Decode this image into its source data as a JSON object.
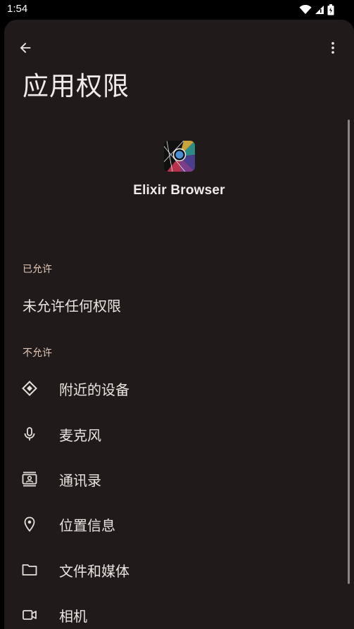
{
  "status_bar": {
    "time": "1:54"
  },
  "header": {
    "title": "应用权限"
  },
  "app": {
    "name": "Elixir Browser"
  },
  "sections": {
    "allowed": {
      "label": "已允许",
      "empty_text": "未允许任何权限"
    },
    "denied": {
      "label": "不允许",
      "items": [
        {
          "label": "附近的设备",
          "icon": "nearby-devices-icon"
        },
        {
          "label": "麦克风",
          "icon": "microphone-icon"
        },
        {
          "label": "通讯录",
          "icon": "contacts-icon"
        },
        {
          "label": "位置信息",
          "icon": "location-icon"
        },
        {
          "label": "文件和媒体",
          "icon": "folder-icon"
        },
        {
          "label": "相机",
          "icon": "camera-icon"
        }
      ]
    }
  },
  "colors": {
    "panel_background": "#201b1a",
    "section_label": "#e6c8b8",
    "text": "#ebe3e0"
  }
}
